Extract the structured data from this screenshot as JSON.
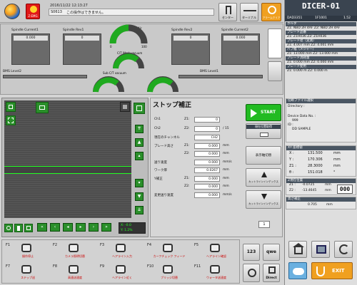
{
  "header": {
    "datetime": "2016/11/22 12:13:27",
    "message_code": "S0613",
    "message_text": "この操作はできません。",
    "emg_label": "Z-EMG",
    "buttons": [
      {
        "label": "センター"
      },
      {
        "label": "ターミナル"
      },
      {
        "label": "アラームクリア"
      }
    ]
  },
  "machine": {
    "name": "DICER-01",
    "model": "DAD3351",
    "serial": "1F1001",
    "version": "1.52"
  },
  "gauges": {
    "spindle1_current": {
      "label": "Spindle Current1",
      "value": "0.000"
    },
    "spindle1_rev": {
      "label": "Spindle Rev1",
      "value": "0"
    },
    "spindle2_rev": {
      "label": "Spindle Rev2",
      "value": "0"
    },
    "spindle2_current": {
      "label": "Spindle Current2",
      "value": "0.000"
    },
    "water_air": {
      "label": "Water Air",
      "low": "0",
      "high": "100"
    },
    "cut_work": {
      "label": "C/T Work vacuum"
    },
    "sub_ct": {
      "label": "Sub C/T vacuum"
    },
    "level1": "BMS Level1",
    "level2": "BMS Level2"
  },
  "main": {
    "title": "ストップ補正",
    "start_label": "START",
    "sub_btn": "現在位置取得",
    "fields": [
      {
        "label": "Ch1",
        "z": "Z1:",
        "value": "0",
        "unit": ""
      },
      {
        "label": "Ch2",
        "z": "Z2:",
        "value": "0",
        "unit": "/ 15"
      },
      {
        "label": "現在のチャンネル",
        "z": "",
        "value": "CH2",
        "unit": ""
      },
      {
        "label": "ブレード高さ",
        "z": "Z1:",
        "value": "0.000",
        "unit": "mm"
      },
      {
        "label": "",
        "z": "Z2:",
        "value": "0.000",
        "unit": "mm"
      },
      {
        "label": "送り速度",
        "z": "",
        "value": "0.000",
        "unit": "mm/s"
      },
      {
        "label": "ワーク厚",
        "z": "",
        "value": "0.0267",
        "unit": "mm"
      },
      {
        "label": "Y補正",
        "z": "Z1:",
        "value": "0.000",
        "unit": "mm"
      },
      {
        "label": "",
        "z": "Z2:",
        "value": "0.000",
        "unit": "mm"
      },
      {
        "label": "変更送り速度",
        "z": "",
        "value": "0.000",
        "unit": "mm/s"
      }
    ],
    "side_buttons": [
      "表示軸切替",
      "カットラインインデックス",
      "カットラインインデックス"
    ],
    "counter": "1"
  },
  "camera": {
    "readout1": "X: -0.0",
    "readout2": "Y: 1.2%"
  },
  "right_panel": {
    "rows": [
      {
        "type": "hdr",
        "text": "ホルダ"
      },
      {
        "type": "row",
        "text": "Z1: NBD 2H 4AF   Z2: NBD 2H 4AF"
      },
      {
        "type": "hdr",
        "text": "ブレード品番"
      },
      {
        "type": "row",
        "text": "Z1: Z1H036      Z2: Z1H036"
      },
      {
        "type": "hdr",
        "text": "ブレード径（実測）"
      },
      {
        "type": "row",
        "text": "Z1: 4.007 mm    Z2: 4.001 mm"
      },
      {
        "type": "hdr",
        "text": "ハブ幅（メジャー）"
      },
      {
        "type": "row",
        "text": "Z1: 13.000 mm   Z2: 13.000 mm"
      },
      {
        "type": "hdr",
        "text": "ブレード消耗量"
      },
      {
        "type": "row",
        "text": "Z1: 0.000 mm    Z2: 0.000 mm"
      },
      {
        "type": "hdr",
        "text": "ブレード使用"
      },
      {
        "type": "row",
        "text": "Z1: 0.000 m     Z2: 0.000 m"
      }
    ],
    "device_hdr": "切断ファイル選択",
    "directory": "Directory :",
    "device_data_no": "Device Data No. :",
    "device_data_value": "999",
    "id_label": "ID :",
    "id_value": "DD SAMPLE",
    "coord_hdr": "XY 座標値",
    "coords": [
      {
        "axis": "X :",
        "value": "131.500",
        "unit": "mm"
      },
      {
        "axis": "Y :",
        "value": "170.306",
        "unit": "mm"
      },
      {
        "axis": "Z1 :",
        "value": "28.3000",
        "unit": "mm"
      },
      {
        "axis": "θ :",
        "value": "151.018",
        "unit": "°"
      }
    ],
    "z_hdr": "Z現在位置",
    "z_values": [
      {
        "axis": "Z1 :",
        "value": "-0.0725",
        "unit": "mm"
      },
      {
        "axis": "Z2 :",
        "value": "-13.4645",
        "unit": "mm"
      }
    ],
    "z_counter": "000",
    "height_hdr": "高さ補正",
    "height_value": "0.705",
    "height_unit": "mm",
    "exit_label": "EXIT"
  },
  "function_keys": [
    {
      "key": "F1",
      "label": "操作停止"
    },
    {
      "key": "F2",
      "label": "カメラ照明切替"
    },
    {
      "key": "F3",
      "label": "ヘアライン入力"
    },
    {
      "key": "F4",
      "label": "カーフチェック フィード"
    },
    {
      "key": "F5",
      "label": "ヘアライン確認"
    },
    {
      "key": "F7",
      "label": "ステップ送"
    },
    {
      "key": "F8",
      "label": "高速送速度"
    },
    {
      "key": "F9",
      "label": "ヘアライン近く"
    },
    {
      "key": "F10",
      "label": "ブリッジ切替"
    },
    {
      "key": "F11",
      "label": "ウォータ送速度"
    }
  ],
  "bottom_right": {
    "num_label": "123",
    "qwe_label": "qwe",
    "direct_label": "Direct"
  }
}
